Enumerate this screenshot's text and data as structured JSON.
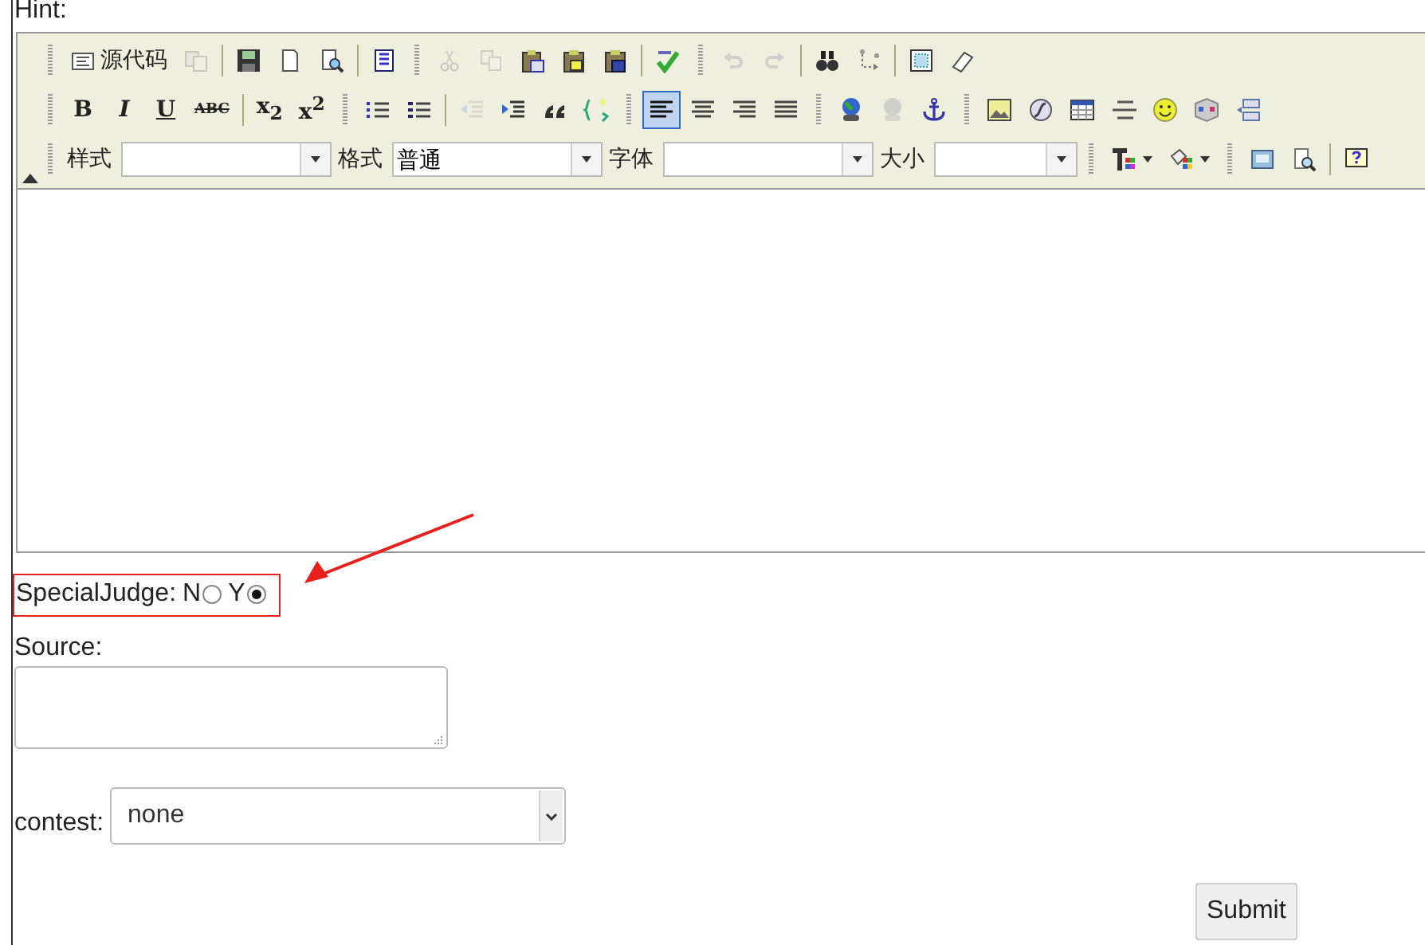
{
  "hint_label": "Hint:",
  "editor": {
    "toolbar_rows": [
      [
        {
          "kind": "grip"
        },
        {
          "kind": "text_button",
          "label": "源代码",
          "disabled": false
        },
        {
          "kind": "button",
          "disabled": true
        },
        {
          "kind": "separator"
        },
        {
          "kind": "button",
          "disabled": false
        },
        {
          "kind": "button",
          "disabled": false
        },
        {
          "kind": "button",
          "disabled": false
        },
        {
          "kind": "separator"
        },
        {
          "kind": "button",
          "disabled": false
        },
        {
          "kind": "grip"
        },
        {
          "kind": "button",
          "disabled": true
        },
        {
          "kind": "button",
          "disabled": true
        },
        {
          "kind": "button",
          "disabled": false
        },
        {
          "kind": "button",
          "disabled": false
        },
        {
          "kind": "button",
          "disabled": false
        },
        {
          "kind": "separator"
        },
        {
          "kind": "button",
          "disabled": false
        },
        {
          "kind": "grip"
        },
        {
          "kind": "button",
          "disabled": true
        },
        {
          "kind": "button",
          "disabled": true
        },
        {
          "kind": "separator"
        },
        {
          "kind": "button",
          "disabled": false
        },
        {
          "kind": "button",
          "disabled": false
        },
        {
          "kind": "separator"
        },
        {
          "kind": "button",
          "disabled": false
        },
        {
          "kind": "button",
          "disabled": false
        }
      ],
      [
        {
          "kind": "grip"
        },
        {
          "kind": "button",
          "label": "B",
          "disabled": false
        },
        {
          "kind": "button",
          "label": "I",
          "disabled": false
        },
        {
          "kind": "button",
          "label": "U",
          "disabled": false
        },
        {
          "kind": "button",
          "label": "ABC",
          "disabled": false
        },
        {
          "kind": "separator"
        },
        {
          "kind": "button",
          "label": "x$_{2}$",
          "disabled": false
        },
        {
          "kind": "button",
          "label": "x$^{2}$",
          "disabled": false
        },
        {
          "kind": "grip"
        },
        {
          "kind": "button",
          "disabled": false
        },
        {
          "kind": "button",
          "disabled": false
        },
        {
          "kind": "separator"
        },
        {
          "kind": "button",
          "disabled": true
        },
        {
          "kind": "button",
          "disabled": false
        },
        {
          "kind": "button",
          "disabled": false
        },
        {
          "kind": "button",
          "disabled": false
        },
        {
          "kind": "grip"
        },
        {
          "kind": "button",
          "disabled": false,
          "selected": true
        },
        {
          "kind": "button",
          "disabled": false,
          "selected": false
        },
        {
          "kind": "button",
          "disabled": false,
          "selected": false
        },
        {
          "kind": "button",
          "disabled": false,
          "selected": false
        },
        {
          "kind": "grip"
        },
        {
          "kind": "button",
          "disabled": false
        },
        {
          "kind": "button",
          "disabled": true
        },
        {
          "kind": "button",
          "disabled": false
        },
        {
          "kind": "grip"
        },
        {
          "kind": "button",
          "disabled": false
        },
        {
          "kind": "button",
          "disabled": false
        },
        {
          "kind": "button",
          "disabled": false
        },
        {
          "kind": "button",
          "disabled": false
        },
        {
          "kind": "button",
          "disabled": false
        },
        {
          "kind": "button",
          "disabled": false
        },
        {
          "kind": "button",
          "disabled": false
        }
      ],
      [
        {
          "kind": "grip"
        },
        {
          "kind": "label",
          "text": "样式"
        },
        {
          "kind": "dropdown"
        },
        {
          "kind": "label",
          "text": "格式"
        },
        {
          "kind": "dropdown",
          "value": "普通"
        },
        {
          "kind": "label",
          "text": "字体"
        },
        {
          "kind": "dropdown"
        },
        {
          "kind": "label",
          "text": "大小"
        },
        {
          "kind": "dropdown"
        },
        {
          "kind": "grip"
        },
        {
          "kind": "button",
          "menu": true,
          "disabled": false
        },
        {
          "kind": "button",
          "menu": true,
          "disabled": false
        },
        {
          "kind": "grip"
        },
        {
          "kind": "button",
          "disabled": false
        },
        {
          "kind": "button",
          "disabled": false
        },
        {
          "kind": "separator"
        },
        {
          "kind": "button",
          "disabled": false
        }
      ]
    ]
  },
  "special_judge": {
    "label": "SpecialJudge:",
    "options": [
      {
        "label": "N",
        "selected": false
      },
      {
        "label": "Y",
        "selected": true
      }
    ]
  },
  "source": {
    "label": "Source:"
  },
  "contest": {
    "label": "contest:",
    "value": "none"
  },
  "submit_button": "Submit"
}
